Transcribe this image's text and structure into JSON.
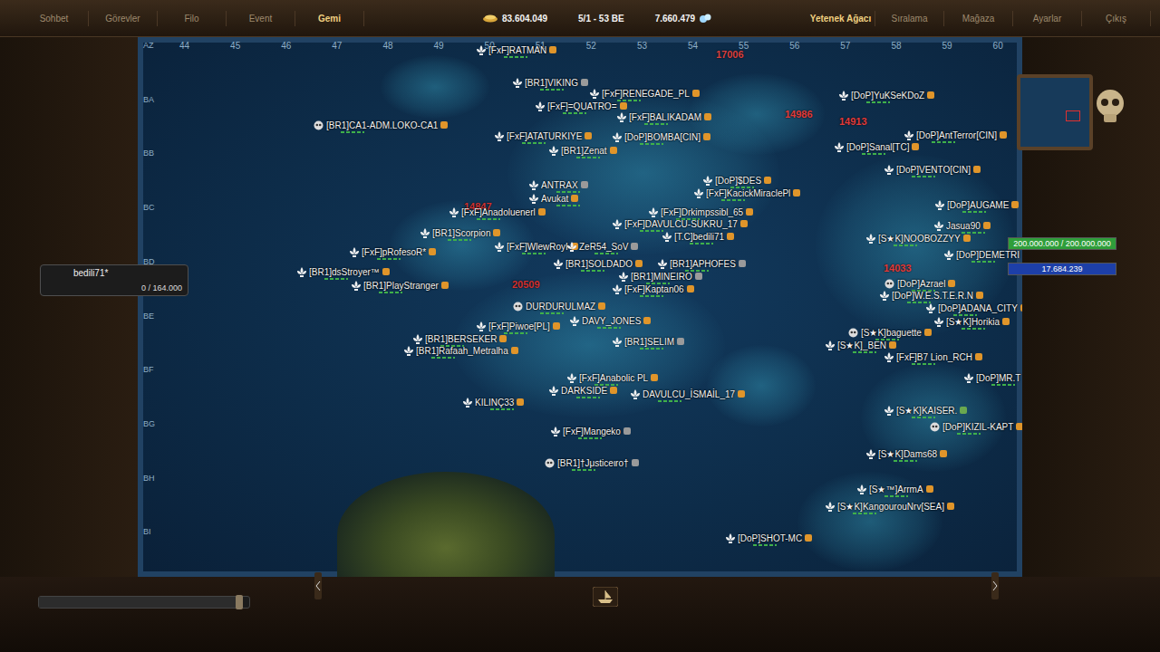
{
  "top_bar": {
    "left_tabs": [
      {
        "label": "Sohbet",
        "selected": false
      },
      {
        "label": "Görevler",
        "selected": false
      },
      {
        "label": "Filo",
        "selected": false
      },
      {
        "label": "Event",
        "selected": false
      },
      {
        "label": "Gemi",
        "selected": true
      }
    ],
    "stats": [
      {
        "value": "83.604.049",
        "kind": "gold"
      },
      {
        "value": "5/1 - 53 BE",
        "kind": "coords"
      },
      {
        "value": "7.660.479",
        "kind": "pearls"
      }
    ],
    "right_tabs": [
      {
        "label": "Yetenek Ağacı",
        "selected": true
      },
      {
        "label": "Sıralama",
        "selected": false
      },
      {
        "label": "Mağaza",
        "selected": false
      },
      {
        "label": "Ayarlar",
        "selected": false
      },
      {
        "label": "Çıkış",
        "selected": false
      }
    ]
  },
  "map": {
    "columns": [
      "44",
      "45",
      "46",
      "47",
      "48",
      "49",
      "50",
      "51",
      "52",
      "53",
      "54",
      "55",
      "56",
      "57",
      "58",
      "59",
      "60"
    ],
    "rows": [
      "AZ",
      "BA",
      "BB",
      "BC",
      "BD",
      "BE",
      "BF",
      "BG",
      "BH",
      "BI"
    ],
    "players": [
      {
        "name": "[FxF]RATMAN",
        "kind": "fleur",
        "color": "#e0952a"
      },
      {
        "name": "[BR1]VIKING",
        "kind": "fleur",
        "color": "#9a9a9a"
      },
      {
        "name": "[FxF]RENEGADE_PL",
        "kind": "fleur",
        "color": "#e0952a"
      },
      {
        "name": "[FxF]=QUATRO=",
        "kind": "fleur",
        "color": "#e0952a"
      },
      {
        "name": "[FxF]BALIKADAM",
        "kind": "fleur",
        "color": "#e0952a"
      },
      {
        "name": "[BR1]CA1-ADM.LOKO-CA1",
        "kind": "skull",
        "color": "#e0952a"
      },
      {
        "name": "[FxF]ATATURKIYE",
        "kind": "fleur",
        "color": "#e0952a"
      },
      {
        "name": "[DoP]BOMBA[CIN]",
        "kind": "fleur",
        "color": "#e0952a"
      },
      {
        "name": "[DoP]YuKSeKDoZ",
        "kind": "fleur",
        "color": "#e0952a"
      },
      {
        "name": "[DoP]AntTerror[CIN]",
        "kind": "fleur",
        "color": "#e0952a"
      },
      {
        "name": "[BR1]Zenat",
        "kind": "fleur",
        "color": "#e0952a"
      },
      {
        "name": "[DoP]Sanal[TC]",
        "kind": "fleur",
        "color": "#e0952a"
      },
      {
        "name": "[DoP]VENTO[CIN]",
        "kind": "fleur",
        "color": "#e0952a"
      },
      {
        "name": "ANTRAX",
        "kind": "fleur",
        "color": "#9a9a9a"
      },
      {
        "name": "[DoP]$DES",
        "kind": "fleur",
        "color": "#e0952a"
      },
      {
        "name": "[FxF]KacickMiraclePl",
        "kind": "fleur",
        "color": "#e0952a"
      },
      {
        "name": "Avukat",
        "kind": "fleur",
        "color": "#e0952a"
      },
      {
        "name": "[DoP]AUGAME",
        "kind": "fleur",
        "color": "#e0952a"
      },
      {
        "name": "[FxF]Anadoluenerl",
        "kind": "fleur",
        "color": "#e0952a"
      },
      {
        "name": "[FxF]Drkimpssibl_65",
        "kind": "fleur",
        "color": "#e0952a"
      },
      {
        "name": "[FxF]DAVULCU-SUKRU_17",
        "kind": "fleur",
        "color": "#e0952a"
      },
      {
        "name": "[BR1]Scorpion",
        "kind": "fleur",
        "color": "#e0952a"
      },
      {
        "name": "Jasua90",
        "kind": "fleur",
        "color": "#e0952a"
      },
      {
        "name": "[T.C]bedili71",
        "kind": "fleur",
        "color": "#e0952a"
      },
      {
        "name": "[S★K]NOOBOZZYY",
        "kind": "fleur",
        "color": "#e0952a"
      },
      {
        "name": "[FxF]WlewRoyI",
        "kind": "fleur",
        "color": "#e0952a"
      },
      {
        "name": "ZeR54_SoV",
        "kind": "fleur",
        "color": "#9a9a9a"
      },
      {
        "name": "[DoP]DEMETRI",
        "kind": "fleur",
        "color": "#e0952a"
      },
      {
        "name": "[FxF]pRofesoR*",
        "kind": "fleur",
        "color": "#e0952a"
      },
      {
        "name": "[BR1]SOLDADO",
        "kind": "fleur",
        "color": "#e0952a"
      },
      {
        "name": "[BR1]APHOFES",
        "kind": "fleur",
        "color": "#9a9a9a"
      },
      {
        "name": "[BR1]dsStroyer™",
        "kind": "fleur",
        "color": "#e0952a"
      },
      {
        "name": "[BR1]MINEIRO",
        "kind": "fleur",
        "color": "#9a9a9a"
      },
      {
        "name": "[BR1]PlayStranger",
        "kind": "fleur",
        "color": "#e0952a"
      },
      {
        "name": "[FxF]Kaptan06",
        "kind": "fleur",
        "color": "#e0952a"
      },
      {
        "name": "[DoP]Azrael",
        "kind": "skull",
        "color": "#e0952a"
      },
      {
        "name": "[DoP]W.E.S.T.E.R.N",
        "kind": "fleur",
        "color": "#e0952a"
      },
      {
        "name": "[DoP]ADANA_CITY",
        "kind": "fleur",
        "color": "#e0952a"
      },
      {
        "name": "DURDURULMAZ",
        "kind": "skull",
        "color": "#e0952a"
      },
      {
        "name": "DAVY_JONES",
        "kind": "fleur",
        "color": "#e0952a"
      },
      {
        "name": "[S★K]Horikia",
        "kind": "fleur",
        "color": "#e0952a"
      },
      {
        "name": "[FxF]Piwoe[PL]",
        "kind": "fleur",
        "color": "#e0952a"
      },
      {
        "name": "[S★K]baguette",
        "kind": "skull",
        "color": "#e0952a"
      },
      {
        "name": "[BR1]BERSEKER",
        "kind": "fleur",
        "color": "#e0952a"
      },
      {
        "name": "[BR1]Rafaah_Metralha",
        "kind": "fleur",
        "color": "#e0952a"
      },
      {
        "name": "[BR1]SELIM",
        "kind": "fleur",
        "color": "#9a9a9a"
      },
      {
        "name": "[S★K]_BEN",
        "kind": "fleur",
        "color": "#e0952a"
      },
      {
        "name": "[FxF]B7 Lion_RCH",
        "kind": "fleur",
        "color": "#e0952a"
      },
      {
        "name": "[DoP]MR.T",
        "kind": "fleur",
        "color": "#e0952a"
      },
      {
        "name": "[FxF]Anabolic PL",
        "kind": "fleur",
        "color": "#e0952a"
      },
      {
        "name": "DARKSIDE",
        "kind": "fleur",
        "color": "#e0952a"
      },
      {
        "name": "DAVULCU_İSMAİL_17",
        "kind": "fleur",
        "color": "#e0952a"
      },
      {
        "name": "KILINÇ33",
        "kind": "fleur",
        "color": "#e0952a"
      },
      {
        "name": "[S★K]KAISER.",
        "kind": "fleur",
        "color": "#6aa84f"
      },
      {
        "name": "[DoP]KIZIL-KAPT",
        "kind": "skull",
        "color": "#e0952a"
      },
      {
        "name": "[FxF]Mangeko",
        "kind": "fleur",
        "color": "#9a9a9a"
      },
      {
        "name": "[S★K]Dams68",
        "kind": "fleur",
        "color": "#e0952a"
      },
      {
        "name": "[BR1]†Jμsticeιro†",
        "kind": "skull",
        "color": "#9a9a9a"
      },
      {
        "name": "[S★™]ArrmA",
        "kind": "fleur",
        "color": "#e0952a"
      },
      {
        "name": "[S★K]KangourouNrv[SEA]",
        "kind": "fleur",
        "color": "#e0952a"
      },
      {
        "name": "[DoP]SHOT-MC",
        "kind": "fleur",
        "color": "#e0952a"
      }
    ],
    "damage": [
      {
        "value": "17006",
        "color": "#d84040"
      },
      {
        "value": "14986",
        "color": "#e03a3a"
      },
      {
        "value": "14913",
        "color": "#e03a3a"
      },
      {
        "value": "14033",
        "color": "#e03a3a"
      },
      {
        "value": "20509",
        "color": "#d03030"
      },
      {
        "value": "14847",
        "color": "#d03030"
      }
    ]
  },
  "player_panel": {
    "name": "bedili71*",
    "cargo": "0 / 164.000"
  },
  "bars": [
    {
      "text": "200.000.000 / 200.000.000",
      "level": 1,
      "color": "#2f9e3a"
    },
    {
      "text": "17.684.239",
      "level": 1,
      "color": "#1d3fa8"
    }
  ],
  "zoom_slider": {
    "level": 0.97
  }
}
